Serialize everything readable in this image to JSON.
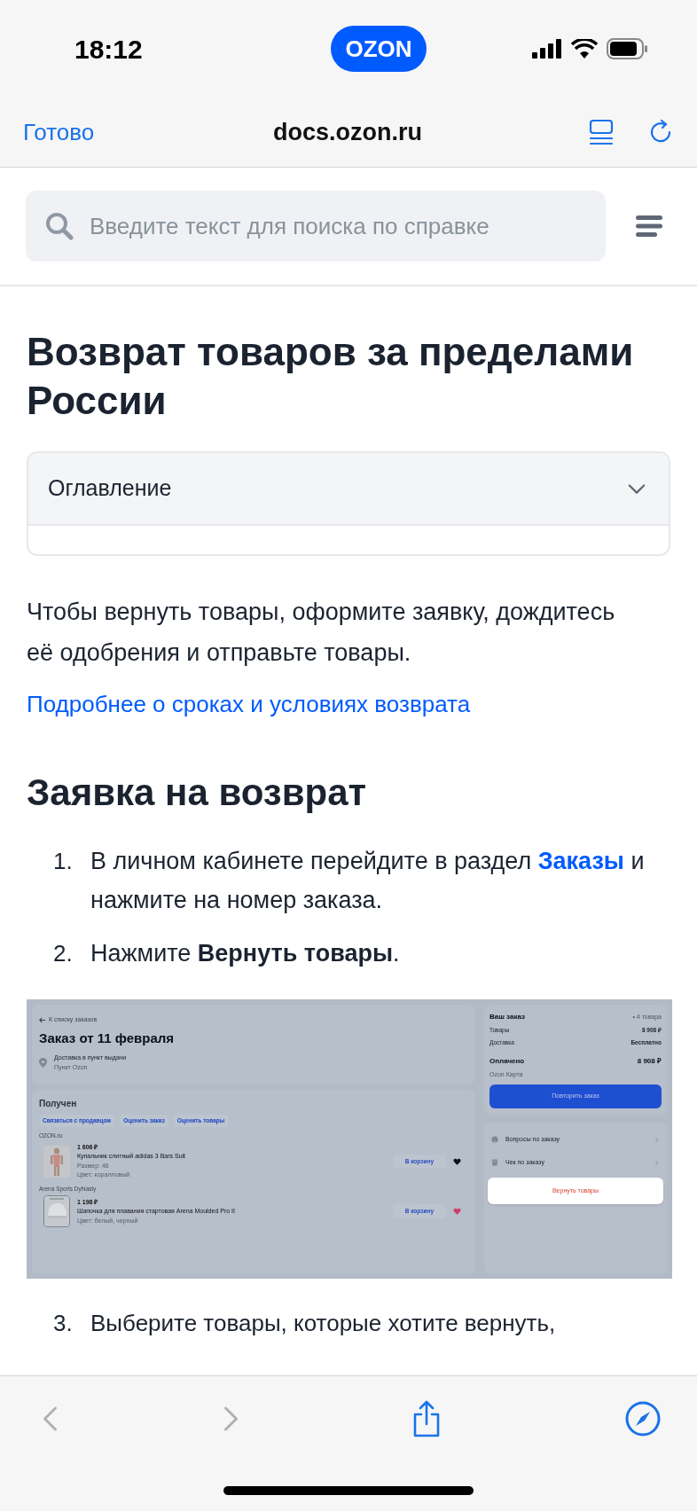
{
  "status_bar": {
    "time": "18:12",
    "badge": "OZON"
  },
  "browser_bar": {
    "done": "Готово",
    "url": "docs.ozon.ru"
  },
  "search": {
    "placeholder": "Введите текст для поиска по справке"
  },
  "article": {
    "title": "Возврат товаров за пределами России",
    "toc": {
      "label": "Оглавление",
      "expanded": false
    },
    "intro": "Чтобы вернуть товары, оформите заявку, дождитесь её одобрения и отправьте товары.",
    "link": "Подробнее о сроках и условиях возврата",
    "section_title": "Заявка на возврат",
    "steps": [
      {
        "number": "1.",
        "parts": [
          {
            "kind": "plain",
            "text": "В личном кабинете перейдите в раздел "
          },
          {
            "kind": "link",
            "text": "Заказы"
          },
          {
            "kind": "plain",
            "text": " и нажмите на номер заказа."
          }
        ]
      },
      {
        "number": "2.",
        "parts": [
          {
            "kind": "plain",
            "text": "Нажмите "
          },
          {
            "kind": "bold",
            "text": "Вернуть товары"
          },
          {
            "kind": "plain",
            "text": "."
          }
        ]
      }
    ],
    "order_screen": {
      "back": "К списку заказов",
      "title": "Заказ от 11 февраля",
      "delivery": {
        "title": "Доставка в пункт выдачи",
        "subtitle": "Пункт Ozon"
      },
      "status": "Получен",
      "actions": [
        "Связаться с продавцом",
        "Оценить заказ",
        "Оценить товары"
      ],
      "sellers": [
        {
          "name": "OZON.ru",
          "items": [
            {
              "price": "1 606 ₽",
              "name": "Купальник слитный adidas 3 Bars Suit",
              "details": [
                "Размер: 46",
                "Цвет: коралловый"
              ],
              "cart": "В корзину",
              "favorite": false
            }
          ]
        },
        {
          "name": "Arena Sports DyNasty",
          "items": [
            {
              "price": "1 198 ₽",
              "name": "Шапочка для плавания стартовая Arena Moulded Pro II",
              "details": [
                "Цвет: белый, черный"
              ],
              "cart": "В корзину",
              "favorite": true
            }
          ]
        }
      ],
      "summary": {
        "title": "Ваш заказ",
        "count": "• 4 товара",
        "rows": [
          {
            "label": "Товары",
            "value": "8 908 ₽"
          },
          {
            "label": "Доставка",
            "value": "Бесплатно"
          }
        ],
        "paid": {
          "label": "Оплачено",
          "value": "8 908 ₽",
          "method": "Ozon Карта"
        },
        "repeat": "Повторить заказ"
      },
      "links": [
        {
          "label": "Вопросы по заказу",
          "kind": "question"
        },
        {
          "label": "Чек по заказу",
          "kind": "receipt"
        }
      ],
      "return_button": {
        "label": "Вернуть товары",
        "highlighted": true
      }
    },
    "next_step": {
      "number": "3.",
      "text": "Выберите товары, которые хотите вернуть,"
    }
  },
  "toolbar": {
    "back_disabled": true,
    "forward_disabled": true
  }
}
